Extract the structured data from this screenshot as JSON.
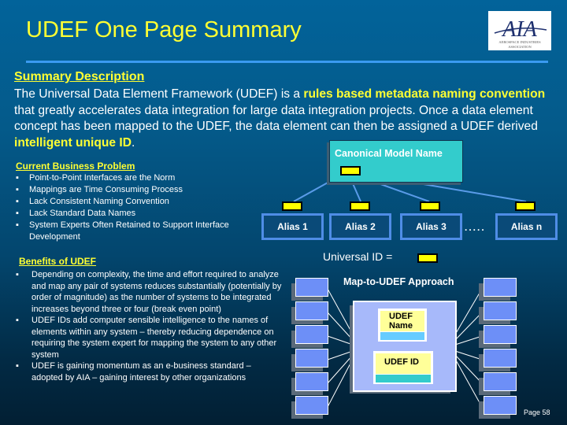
{
  "header": {
    "title": "UDEF One Page Summary",
    "logo": {
      "text": "AIA",
      "caption_line1": "AEROSPACE INDUSTRIES",
      "caption_line2": "ASSOCIATION"
    }
  },
  "summary": {
    "heading": "Summary Description",
    "parts": [
      {
        "text": "The Universal Data Element Framework (UDEF) is a ",
        "highlight": false
      },
      {
        "text": "rules based metadata naming convention",
        "highlight": true
      },
      {
        "text": " that greatly accelerates data integration for large data integration projects. Once a data element concept has been mapped to the UDEF, the data element can then be assigned a UDEF derived ",
        "highlight": false
      },
      {
        "text": "intelligent unique ID",
        "highlight": true
      },
      {
        "text": ".",
        "highlight": false
      }
    ]
  },
  "current_problem": {
    "heading": "Current Business Problem",
    "bullet": "▪",
    "items": [
      "Point-to-Point Interfaces are the Norm",
      "Mappings are Time Consuming Process",
      "Lack Consistent Naming Convention",
      "Lack Standard Data Names",
      "System Experts Often Retained to Support Interface Development"
    ]
  },
  "benefits": {
    "heading": "Benefits of UDEF",
    "bullet": "▪",
    "items": [
      "Depending on complexity, the time and effort required to analyze and map any pair of systems reduces substantially (potentially by order of magnitude) as the number of systems to be integrated increases beyond three or four (break even point)",
      "UDEF IDs add computer sensible intelligence to the names of elements within any system – thereby reducing dependence on requiring the system expert for mapping the system to any other system",
      "UDEF is gaining momentum as an e-business standard – adopted by AIA – gaining interest by other organizations"
    ]
  },
  "canonical_diagram": {
    "canonical_label": "Canonical Model Name",
    "aliases": [
      "Alias 1",
      "Alias 2",
      "Alias 3",
      "Alias n"
    ],
    "ellipsis": ".....",
    "universal_id_label": "Universal ID ="
  },
  "map_diagram": {
    "title": "Map-to-UDEF Approach",
    "udef_name_label": "UDEF Name",
    "udef_id_label": "UDEF ID",
    "systems_per_side": 6
  },
  "footer": {
    "page": "Page 58"
  },
  "colors": {
    "accent_yellow": "#ffff33",
    "rule_blue": "#3a9af0",
    "canonical_teal": "#33cccc",
    "system_blue": "#6d8ff7"
  }
}
